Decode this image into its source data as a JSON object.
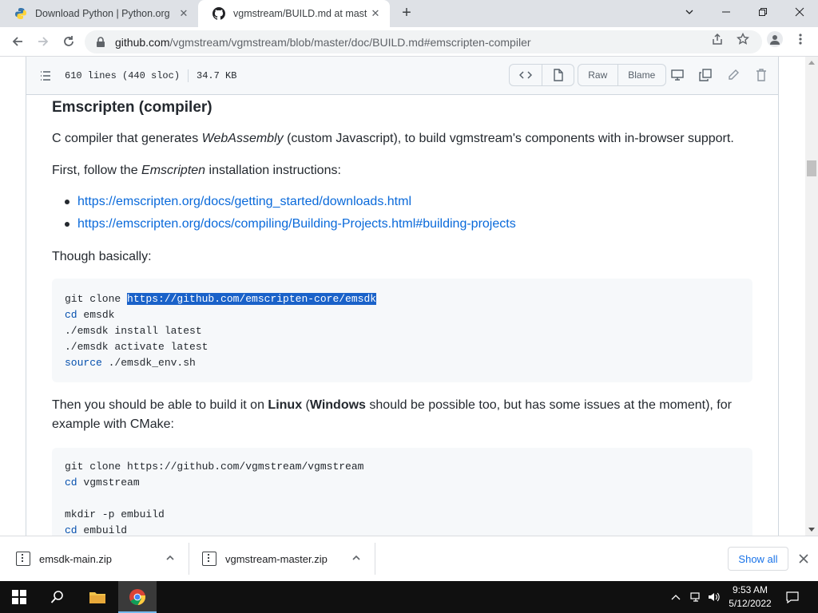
{
  "browser": {
    "tabs": [
      {
        "title": "Download Python | Python.org",
        "favicon": "python-icon"
      },
      {
        "title": "vgmstream/BUILD.md at master",
        "favicon": "github-icon",
        "active": true
      }
    ],
    "new_tab_label": "+",
    "url_host": "github.com",
    "url_path": "/vgmstream/vgmstream/blob/master/doc/BUILD.md#emscripten-compiler"
  },
  "file_header": {
    "lines": "610 lines (440 sloc)",
    "size": "34.7 KB",
    "raw_label": "Raw",
    "blame_label": "Blame"
  },
  "article": {
    "heading": "Emscripten (compiler)",
    "p1_a": "C compiler that generates ",
    "p1_em": "WebAssembly",
    "p1_b": " (custom Javascript), to build vgmstream's components with in-browser support.",
    "p2_a": "First, follow the ",
    "p2_em": "Emscripten",
    "p2_b": " installation instructions:",
    "links": [
      "https://emscripten.org/docs/getting_started/downloads.html",
      "https://emscripten.org/docs/compiling/Building-Projects.html#building-projects"
    ],
    "p3": "Though basically:",
    "code1": {
      "l1_prefix": "git clone ",
      "l1_selected": "https://github.com/emscripten-core/emsdk",
      "l2_kw": "cd",
      "l2_rest": " emsdk",
      "l3": "./emsdk install latest",
      "l4": "./emsdk activate latest",
      "l5_kw": "source",
      "l5_rest": " ./emsdk_env.sh"
    },
    "p4_a": "Then you should be able to build it on ",
    "p4_b1": "Linux",
    "p4_c": " (",
    "p4_b2": "Windows",
    "p4_d": " should be possible too, but has some issues at the moment), for",
    "p4_e": "example with CMake:",
    "code2": {
      "l1": "git clone https://github.com/vgmstream/vgmstream",
      "l2_kw": "cd",
      "l2_rest": " vgmstream",
      "l3": "",
      "l4": "mkdir -p embuild",
      "l5_kw": "cd",
      "l5_rest": " embuild"
    }
  },
  "downloads": {
    "items": [
      "emsdk-main.zip",
      "vgmstream-master.zip"
    ],
    "show_all": "Show all"
  },
  "taskbar": {
    "time": "9:53 AM",
    "date": "5/12/2022"
  }
}
